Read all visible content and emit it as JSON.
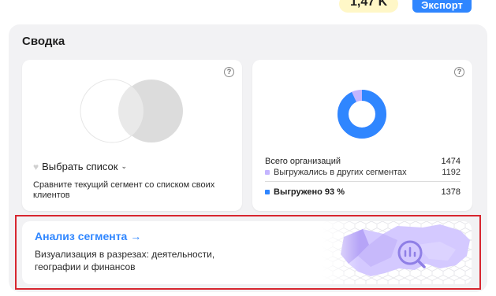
{
  "header": {
    "count_badge": "1,47 K",
    "export_label": "Экспорт"
  },
  "summary": {
    "title": "Сводка",
    "compare_card": {
      "help": "?",
      "choose_list_label": "Выбрать список",
      "description": "Сравните текущий сегмент со списком своих клиентов"
    },
    "stats_card": {
      "help": "?",
      "donut": {
        "exported_fraction": 0.93,
        "colors": {
          "exported": "#2f86ff",
          "other": "#c4b5ff"
        }
      },
      "total_label": "Всего организаций",
      "total_value": "1474",
      "other_label": "Выгружались в других сегментах",
      "other_value": "1192",
      "exported_label": "Выгружено 93 %",
      "exported_value": "1378"
    }
  },
  "analysis": {
    "title": "Анализ сегмента",
    "arrow": "→",
    "description": "Визуализация в разрезах: деятельности, географии и финансов"
  },
  "colors": {
    "accent": "#2f86ff",
    "highlight_border": "#d7262f",
    "panel_bg": "#f2f2f4",
    "map_purple": "#c4b5ff"
  }
}
